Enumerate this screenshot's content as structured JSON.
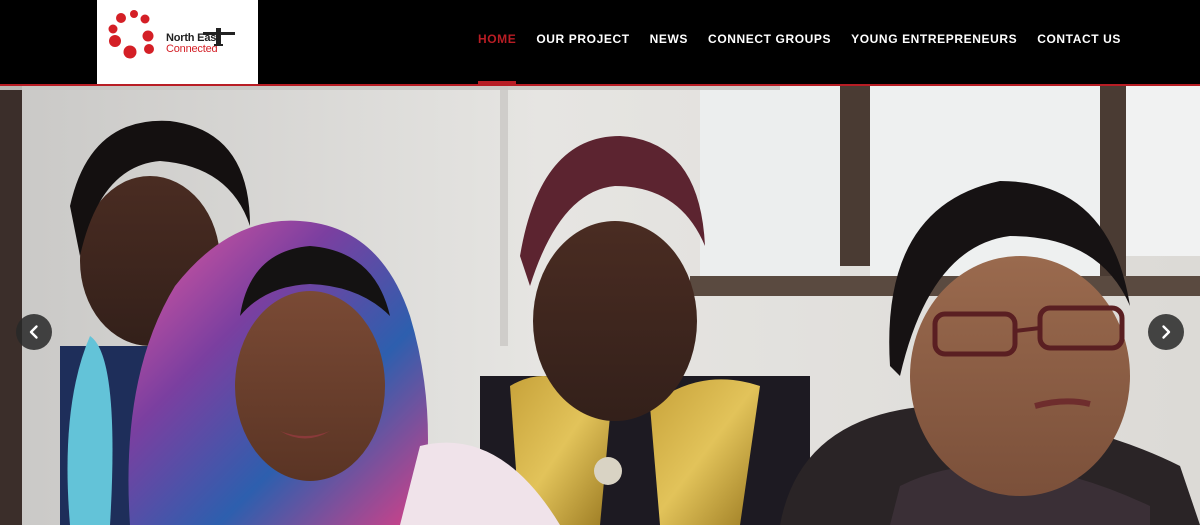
{
  "brand": {
    "logo_line1": "North East",
    "logo_line2": "Connected",
    "accent_color": "#b81d24"
  },
  "nav": {
    "items": [
      {
        "label": "HOME",
        "active": true
      },
      {
        "label": "OUR PROJECT",
        "active": false
      },
      {
        "label": "NEWS",
        "active": false
      },
      {
        "label": "CONNECT GROUPS",
        "active": false
      },
      {
        "label": "YOUNG ENTREPRENEURS",
        "active": false
      },
      {
        "label": "CONTACT US",
        "active": false
      }
    ]
  },
  "hero": {
    "slide_progress": 0.65,
    "prev_icon": "chevron-left-icon",
    "next_icon": "chevron-right-icon"
  }
}
